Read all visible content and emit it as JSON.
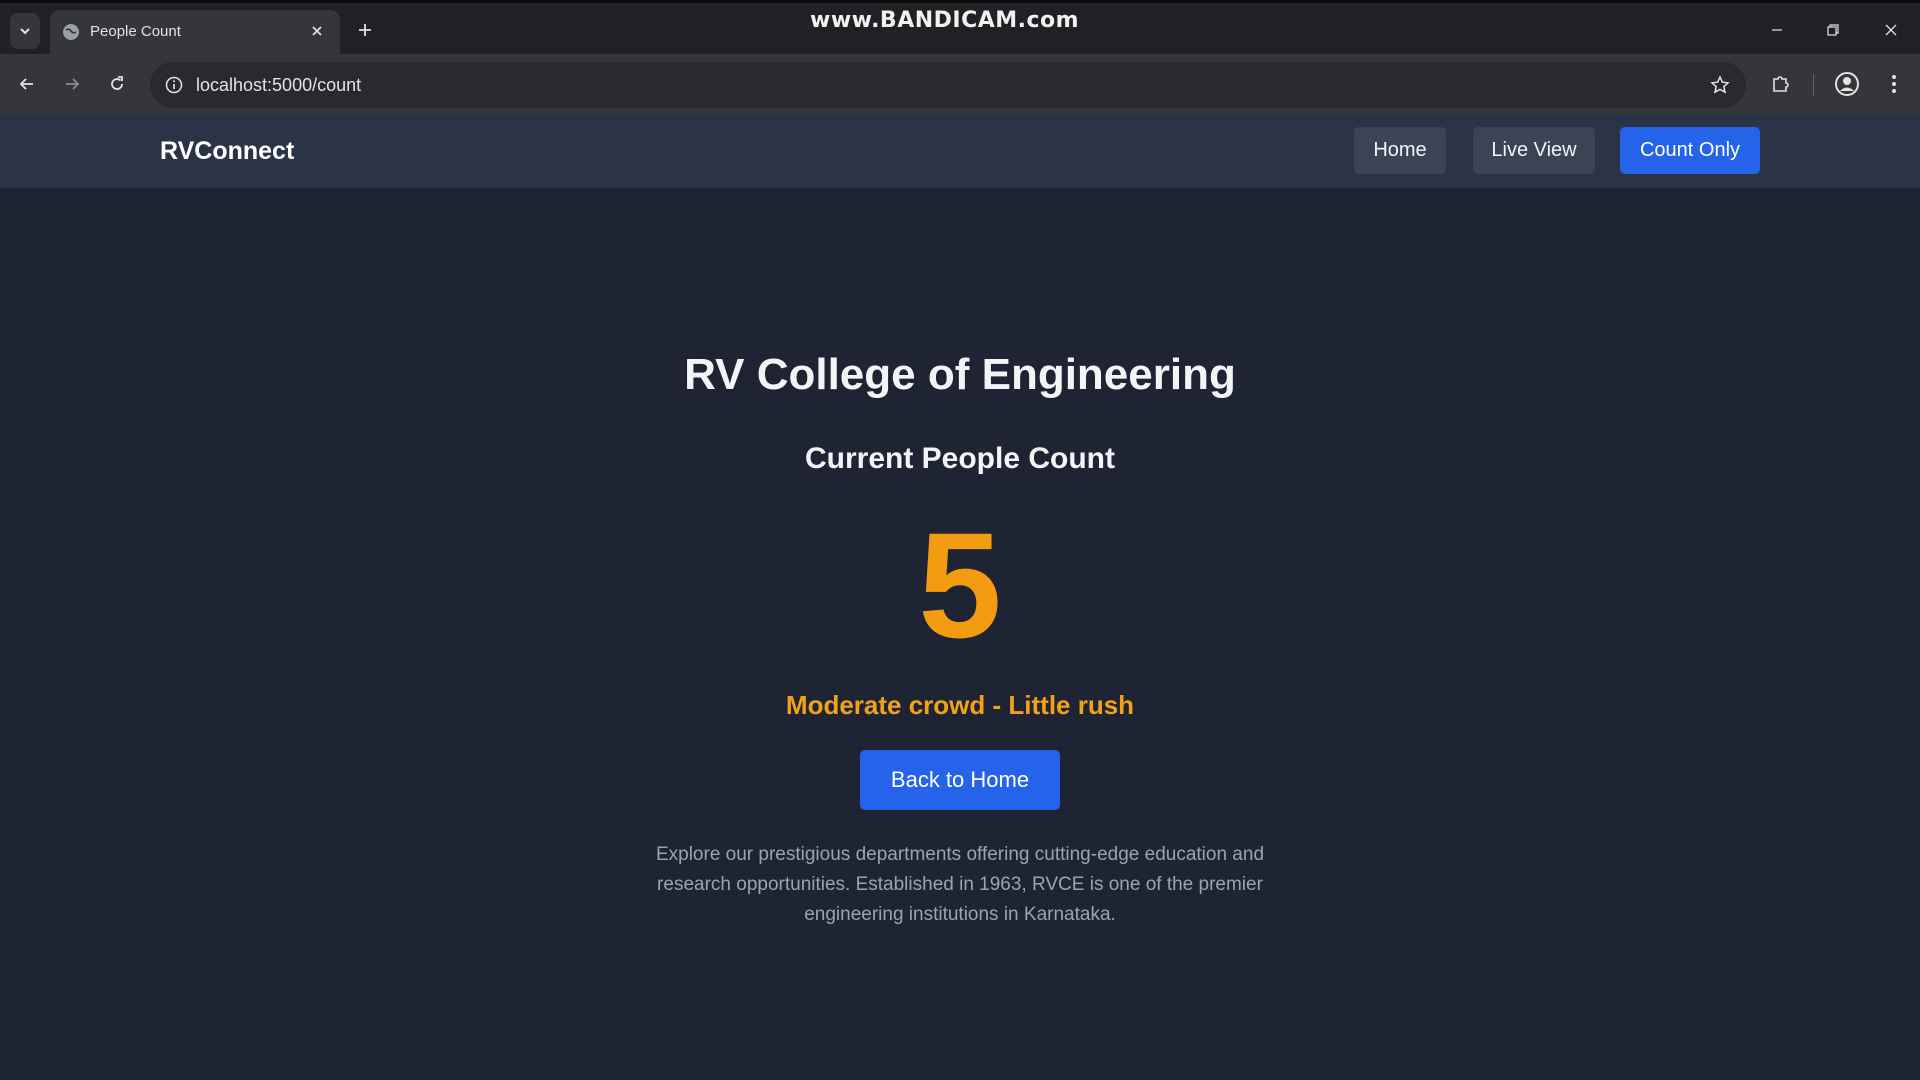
{
  "browser": {
    "tab": {
      "title": "People Count",
      "favicon": "globe-icon"
    },
    "watermark": "www.BANDICAM.com",
    "address_bar": {
      "url": "localhost:5000/count"
    },
    "icons": {
      "tab_list": "chevron-down-icon",
      "new_tab": "plus-icon",
      "back": "arrow-left-icon",
      "forward": "arrow-right-icon",
      "reload": "reload-icon",
      "site_info": "info-icon",
      "bookmark": "star-icon",
      "extensions": "puzzle-icon",
      "profile": "profile-icon",
      "menu": "kebab-menu-icon"
    }
  },
  "navbar": {
    "brand": "RVConnect",
    "links": [
      {
        "label": "Home",
        "active": false
      },
      {
        "label": "Live View",
        "active": false
      },
      {
        "label": "Count Only",
        "active": true
      }
    ]
  },
  "main": {
    "title": "RV College of Engineering",
    "subtitle": "Current People Count",
    "count": "5",
    "status": "Moderate crowd - Little rush",
    "back_button": "Back to Home",
    "description": "Explore our prestigious departments offering cutting-edge education and research opportunities. Established in 1963, RVCE is one of the premier engineering institutions in Karnataka."
  },
  "colors": {
    "page_bg": "#1f2435",
    "navbar_bg": "#2b3446",
    "accent_blue": "#2563eb",
    "count_orange": "#f39c12",
    "status_orange": "#f0a21a"
  }
}
